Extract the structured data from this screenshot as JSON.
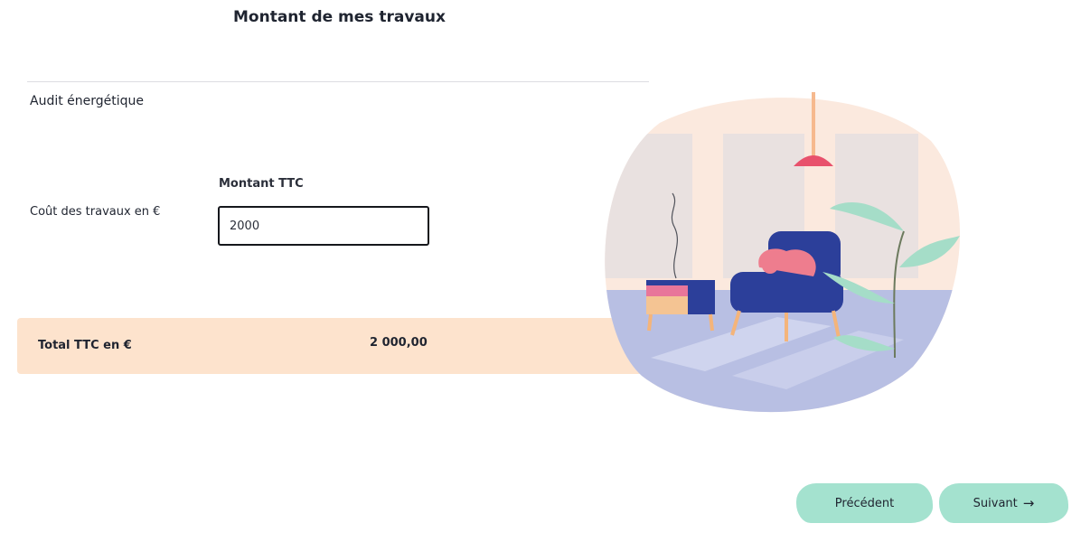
{
  "header": {
    "title": "Montant de mes travaux"
  },
  "section": {
    "title": "Audit énergétique"
  },
  "table": {
    "column_header": "Montant TTC",
    "row_label": "Coût des travaux en €",
    "input_value": "2000"
  },
  "total": {
    "label": "Total TTC en €",
    "value": "2 000,00"
  },
  "navigation": {
    "previous_label": "Précédent",
    "next_label": "Suivant",
    "next_icon": "arrow-right-icon"
  },
  "colors": {
    "total_band": "#fde3cd",
    "button": "#a4e2cf",
    "text": "#1f2430",
    "input_border": "#15171c"
  }
}
